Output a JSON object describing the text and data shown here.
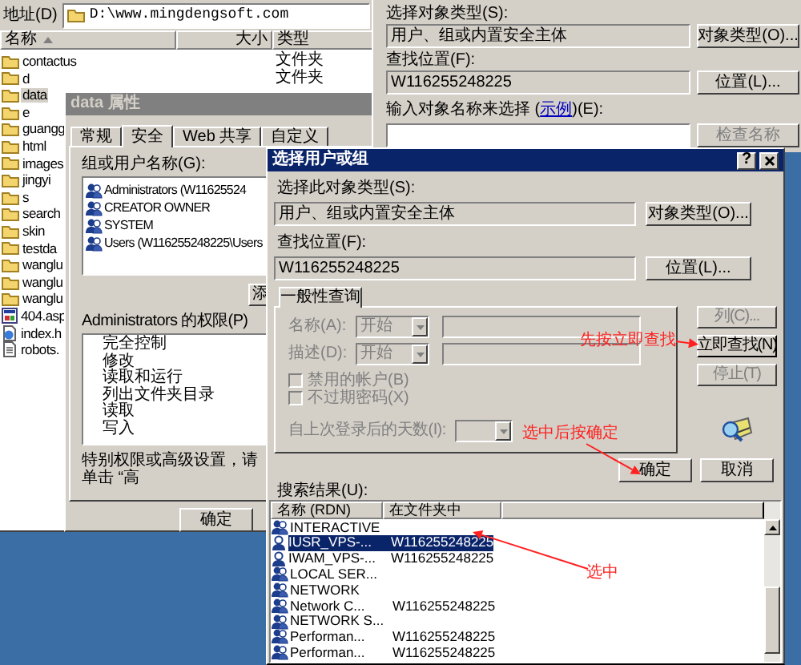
{
  "explorer": {
    "address_label": "地址(D)",
    "address": "D:\\www.mingdengsoft.com",
    "columns": [
      "名称",
      "大小",
      "类型"
    ],
    "files": [
      {
        "name": "contactus",
        "kind": "folder",
        "type": "文件夹",
        "selected": false
      },
      {
        "name": "d",
        "kind": "folder",
        "type": "文件夹",
        "selected": false
      },
      {
        "name": "data",
        "kind": "folder",
        "selected": true
      },
      {
        "name": "e",
        "kind": "folder",
        "selected": false
      },
      {
        "name": "guangg",
        "kind": "folder",
        "selected": false
      },
      {
        "name": "html",
        "kind": "folder",
        "selected": false
      },
      {
        "name": "images",
        "kind": "folder",
        "selected": false
      },
      {
        "name": "jingyi",
        "kind": "folder",
        "selected": false
      },
      {
        "name": "s",
        "kind": "folder",
        "selected": false
      },
      {
        "name": "search",
        "kind": "folder",
        "selected": false
      },
      {
        "name": "skin",
        "kind": "folder",
        "selected": false
      },
      {
        "name": "testda",
        "kind": "folder",
        "selected": false
      },
      {
        "name": "wanglu",
        "kind": "folder",
        "selected": false
      },
      {
        "name": "wanglu",
        "kind": "folder",
        "selected": false
      },
      {
        "name": "wanglu",
        "kind": "folder",
        "selected": false
      },
      {
        "name": "404.asp",
        "kind": "script",
        "selected": false
      },
      {
        "name": "index.h",
        "kind": "web",
        "selected": false
      },
      {
        "name": "robots.",
        "kind": "text",
        "selected": false
      }
    ]
  },
  "properties": {
    "title": "data 属性",
    "tabs": [
      {
        "label": "常规",
        "selected": false
      },
      {
        "label": "安全",
        "selected": true
      },
      {
        "label": "Web 共享",
        "selected": false
      },
      {
        "label": "自定义",
        "selected": false
      }
    ],
    "users_label": "组或用户名称(G):",
    "users": [
      "Administrators (W11625524",
      "CREATOR OWNER",
      "SYSTEM",
      "Users (W116255248225\\Users"
    ],
    "add_button": "添",
    "permissions_label": "Administrators 的权限(P)",
    "permissions": [
      "完全控制",
      "修改",
      "读取和运行",
      "列出文件夹目录",
      "读取",
      "写入"
    ],
    "note": "特别权限或高级设置，请单击 “高",
    "ok_button": "确定"
  },
  "object_dialog": {
    "object_type_label": "选择对象类型(S):",
    "object_type": "用户、组或内置安全主体",
    "object_type_button": "对象类型(O)...",
    "location_label": "查找位置(F):",
    "location": "W116255248225",
    "location_button": "位置(L)...",
    "name_prompt": "输入对象名称来选择 (",
    "name_prompt_link": "示例",
    "name_prompt_end": ")(E):",
    "check_button": "检查名称"
  },
  "dialog": {
    "title": "选择用户或组",
    "help_button": "?",
    "object_type_label": "选择此对象类型(S):",
    "object_type": "用户、组或内置安全主体",
    "object_type_button": "对象类型(O)...",
    "location_label": "查找位置(F):",
    "location": "W116255248225",
    "location_button": "位置(L)...",
    "query": {
      "tab": "一般性查询",
      "disabled": true,
      "fields": [
        {
          "label": "名称(A):",
          "match": "开始"
        },
        {
          "label": "描述(D):",
          "match": "开始"
        }
      ],
      "checkboxes": [
        {
          "label": "禁用的帐户(B)",
          "checked": false
        },
        {
          "label": "不过期密码(X)",
          "checked": false
        }
      ],
      "days_label": "自上次登录后的天数(I):"
    },
    "side_buttons": [
      {
        "label": "列(C)...",
        "disabled": true,
        "default": false
      },
      {
        "label": "立即查找(N)",
        "disabled": false,
        "default": true
      },
      {
        "label": "停止(T)",
        "disabled": true,
        "default": false
      }
    ],
    "ok_button": "确定",
    "cancel_button": "取消",
    "results": {
      "label": "搜索结果(U):",
      "columns": [
        "名称 (RDN)",
        "在文件夹中"
      ],
      "rows": [
        {
          "name": "INTERACTIVE",
          "kind": "group",
          "selected": false
        },
        {
          "name": "IUSR_VPS-...",
          "folder": "W116255248225",
          "kind": "user",
          "selected": true
        },
        {
          "name": "IWAM_VPS-...",
          "folder": "W116255248225",
          "kind": "user",
          "selected": false
        },
        {
          "name": "LOCAL SER...",
          "kind": "group",
          "selected": false
        },
        {
          "name": "NETWORK",
          "kind": "group",
          "selected": false
        },
        {
          "name": "Network C...",
          "folder": "W116255248225",
          "kind": "group",
          "selected": false
        },
        {
          "name": "NETWORK S...",
          "kind": "group",
          "selected": false
        },
        {
          "name": "Performan...",
          "folder": "W116255248225",
          "kind": "group",
          "selected": false
        },
        {
          "name": "Performan...",
          "folder": "W116255248225",
          "kind": "group",
          "selected": false
        }
      ]
    }
  },
  "annotations": [
    {
      "text": "先按立即查找"
    },
    {
      "text": "选中后按确定"
    },
    {
      "text": "选中"
    }
  ]
}
